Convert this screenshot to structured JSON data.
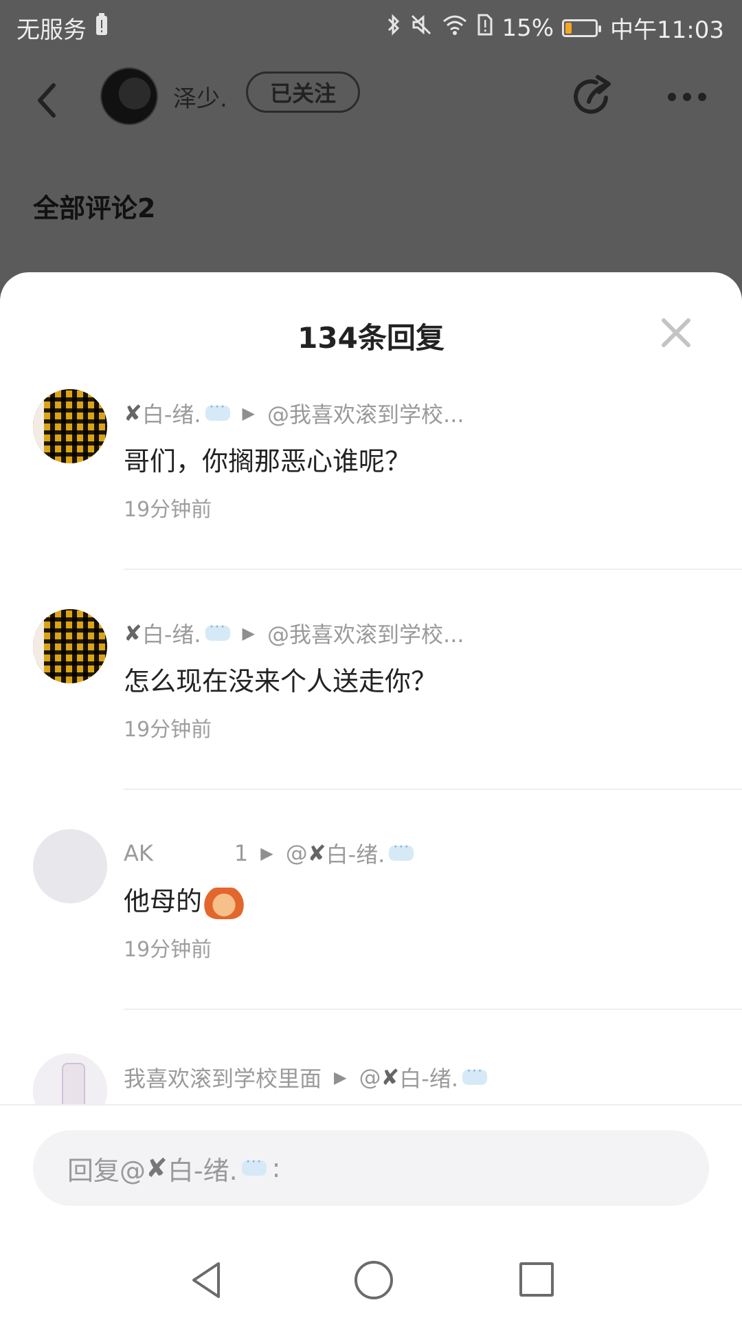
{
  "status_bar": {
    "carrier": "无服务",
    "battery_percent": "15%",
    "battery_level": 0.15,
    "time": "中午11:03"
  },
  "header": {
    "owner_name": "泽少.",
    "follow_label": "已关注"
  },
  "comments_section": {
    "label": "全部评论2"
  },
  "sheet": {
    "title": "134条回复",
    "replies": [
      {
        "author": "白-绪.",
        "reply_to": "@我喜欢滚到学校...",
        "content": "哥们，你搁那恶心谁呢？",
        "time": "19分钟前"
      },
      {
        "author": "白-绪.",
        "reply_to": "@我喜欢滚到学校...",
        "content": "怎么现在没来个人送走你？",
        "time": "19分钟前"
      },
      {
        "author": "AK",
        "count": "1",
        "reply_to": "白-绪.",
        "reply_to_prefix": "@",
        "content": "他母的",
        "time": "19分钟前"
      },
      {
        "author": "我喜欢滚到学校里面",
        "reply_to": "白-绪.",
        "reply_to_prefix": "@"
      }
    ]
  },
  "reply_box": {
    "prefix": "回复@",
    "name": "白-绪.",
    "suffix": ":"
  },
  "icons": {
    "back": "chevron-left-icon",
    "share": "share-icon",
    "more": "more-icon",
    "close": "close-icon",
    "nav_back": "triangle-back-icon",
    "nav_home": "circle-home-icon",
    "nav_recent": "square-recent-icon"
  }
}
